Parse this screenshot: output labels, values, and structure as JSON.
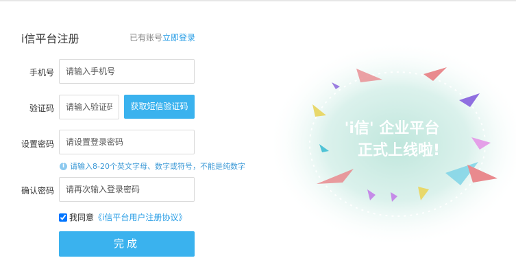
{
  "header": {
    "title": "i信平台注册",
    "have_account_text": "已有账号",
    "login_link": "立即登录"
  },
  "form": {
    "phone": {
      "label": "手机号",
      "placeholder": "请输入手机号"
    },
    "code": {
      "label": "验证码",
      "placeholder": "请输入验证码",
      "button": "获取短信验证码"
    },
    "password": {
      "label": "设置密码",
      "placeholder": "请设置登录密码",
      "hint": "请输入8-20个英文字母、数字或符号，不能是纯数字"
    },
    "confirm": {
      "label": "确认密码",
      "placeholder": "请再次输入登录密码"
    },
    "agree": {
      "checked": true,
      "text": "我同意",
      "link": "《i信平台用户注册协议》"
    },
    "submit": "完成"
  },
  "promo": {
    "line1": "'i信' 企业平台",
    "line2": "正式上线啦!"
  },
  "colors": {
    "accent": "#3ab2ee",
    "link": "#2a9ee6"
  }
}
